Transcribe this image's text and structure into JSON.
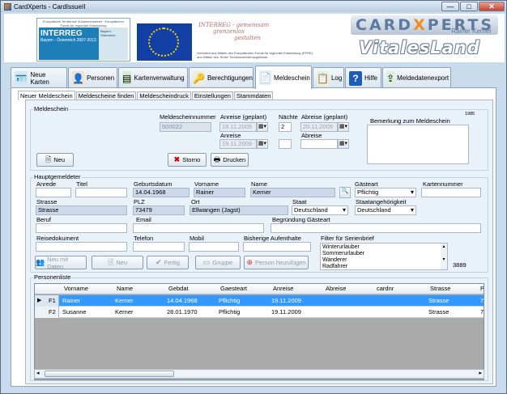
{
  "window": {
    "title": "CardXperts - CardIssueII",
    "min": "—",
    "max": "□",
    "close": "✕"
  },
  "banner": {
    "interreg_top": "Europäische Territoriale Zusammenarbeit · Europäischer Fonds für regionale Entwicklung",
    "interreg_name": "INTERREG",
    "interreg_sub": "Bayern - Österreich 2007-2013",
    "interreg_map": "Bayern · Österreich",
    "slogan": [
      "INTERREG - gemeinsam",
      "grenzenlos",
      "gestalten"
    ],
    "funding": "Gefördert aus Mitteln des Europäischen Fonds für regionale Entwicklung (EFRE), aus Mitteln des Tiroler Tourismusförderungsfonds",
    "logo_a": "CARD",
    "logo_x": "X",
    "logo_b": "PERTS",
    "logo_sub": "Rainer Kerner",
    "vital": "VitalesLand"
  },
  "main_tabs": [
    {
      "label": "Neue Karten"
    },
    {
      "label": "Personen"
    },
    {
      "label": "Kartenverwaltung"
    },
    {
      "label": "Berechtigungen"
    },
    {
      "label": "Meldeschein"
    },
    {
      "label": "Log"
    },
    {
      "label": "Hilfe"
    },
    {
      "label": "Meldedatenexport"
    }
  ],
  "sub_tabs": [
    "Neuer Meldeschein",
    "Meldescheine finden",
    "Meldescheindruck",
    "Einstellungen",
    "Stammdaten"
  ],
  "meldeschein": {
    "group": "Meldeschein",
    "nr_label": "Meldescheinnummer",
    "nr": "500022",
    "anreise_geplant_label": "Anreise (geplant)",
    "anreise_geplant": "18.11.2009",
    "naechte_label": "Nächte",
    "naechte": "2",
    "abreise_geplant_label": "Abreise (geplant)",
    "abreise_geplant": "20.11.2009",
    "anreise_label": "Anreise",
    "anreise": "19.11.2009",
    "abreise_label": "Abreise",
    "abreise": "",
    "bemerkung_label": "Bemerkung zum Meldeschein",
    "count": "1985",
    "neu": "Neu",
    "storno": "Storno",
    "drucken": "Drucken"
  },
  "haupt": {
    "group": "Hauptgemeldeter",
    "anrede_label": "Anrede",
    "titel_label": "Titel",
    "geb_label": "Geburtsdatum",
    "geb": "14.04.1968",
    "vorname_label": "Vorname",
    "vorname": "Rainer",
    "name_label": "Name",
    "name": "Kerner",
    "gaesteart_label": "Gästeart",
    "gaesteart": "Pflichtig",
    "kartennr_label": "Kartennummer",
    "strasse_label": "Strasse",
    "strasse": "Strasse",
    "plz_label": "PLZ",
    "plz": "73479",
    "ort_label": "Ort",
    "ort": "Ellwangen (Jagst)",
    "staat_label": "Staat",
    "staat": "Deutschland",
    "staatsang_label": "Staatangehörigkeit",
    "staatsang": "Deutschland",
    "beruf_label": "Beruf",
    "email_label": "Email",
    "begruendung_label": "Begründung Gästeart",
    "reisedok_label": "Reisedokument",
    "telefon_label": "Telefon",
    "mobil_label": "Mobil",
    "bisherige_label": "Bisherige Aufenthalte",
    "filter_label": "Filter für Serienbrief",
    "filter_items": [
      "Winterurlauber",
      "Sommerurlauber",
      "Wanderer",
      "Radfahrer"
    ],
    "filter_count": "3889",
    "btn_neu_daten": "Neu mit Daten",
    "btn_neu": "Neu",
    "btn_fertig": "Fertig",
    "btn_gruppe": "Gruppe",
    "btn_person": "Person hinzufügen"
  },
  "personenliste": {
    "label": "Personenliste",
    "columns": [
      "Vorname",
      "Name",
      "Gebdat",
      "Gaesteart",
      "Anreise",
      "Abreise",
      "cardnr",
      "Strasse",
      "P"
    ],
    "rows": [
      {
        "key": "F1",
        "cells": [
          "Rainer",
          "Kerner",
          "14.04.1968",
          "Pflichtig",
          "19.11.2009",
          "",
          "",
          "Strasse",
          "7"
        ]
      },
      {
        "key": "F2",
        "cells": [
          "Susanne",
          "Kerner",
          "28.01.1970",
          "Pflichtig",
          "19.11.2009",
          "",
          "",
          "Strasse",
          "7"
        ]
      }
    ]
  },
  "colors": {
    "selection": "#3399ff",
    "window_bg": "#c9dcee"
  }
}
